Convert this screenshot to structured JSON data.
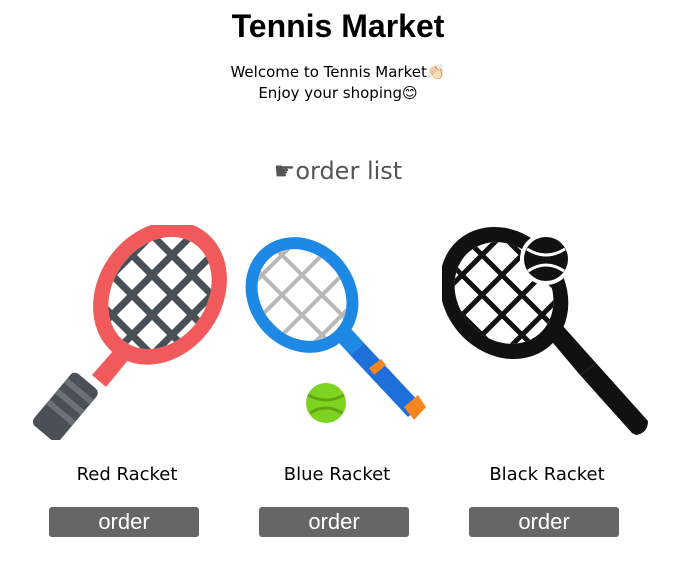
{
  "header": {
    "title": "Tennis Market",
    "welcome_line1": "Welcome to Tennis Market👏🏻",
    "welcome_line2": "Enjoy your shoping😊"
  },
  "section": {
    "title": "☛order list"
  },
  "products": [
    {
      "name": "Red Racket",
      "button_label": "order",
      "icon": "red-racket-icon",
      "color": "#f05a5a"
    },
    {
      "name": "Blue Racket",
      "button_label": "order",
      "icon": "blue-racket-with-ball-icon",
      "color": "#1e88e5"
    },
    {
      "name": "Black Racket",
      "button_label": "order",
      "icon": "black-racket-with-ball-icon",
      "color": "#111111"
    }
  ]
}
